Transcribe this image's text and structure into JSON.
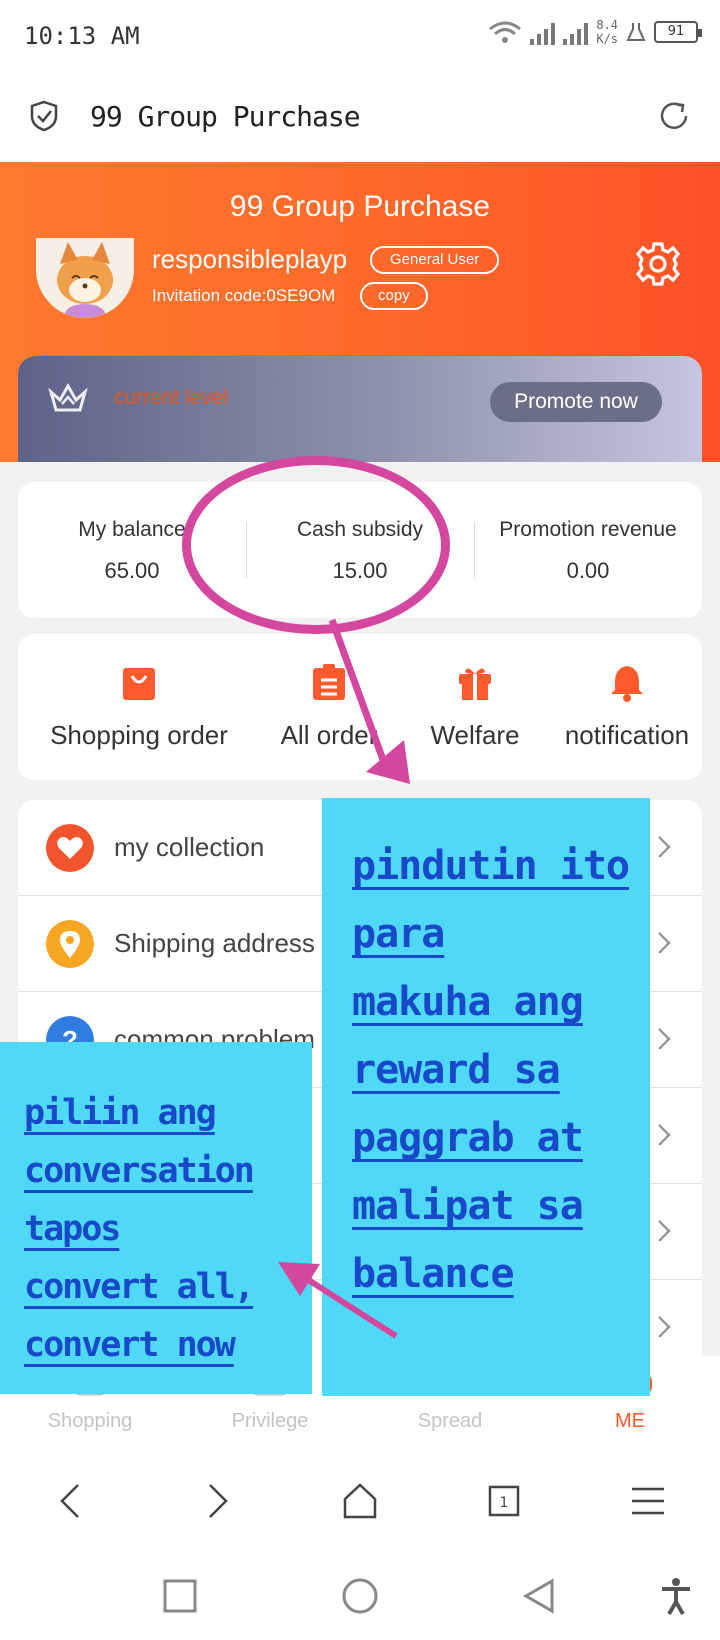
{
  "status_bar": {
    "time": "10:13 AM",
    "net_speed_value": "8.4",
    "net_speed_unit": "K/s",
    "battery": "91"
  },
  "browser": {
    "title": "99 Group Purchase"
  },
  "header": {
    "title": "99 Group Purchase",
    "username": "responsibleplayp",
    "role": "General User",
    "invitation": "Invitation code:0SE9OM",
    "copy_label": "copy"
  },
  "level": {
    "label": "current level",
    "promote_label": "Promote now"
  },
  "balances": [
    {
      "label": "My balance",
      "value": "65.00"
    },
    {
      "label": "Cash subsidy",
      "value": "15.00"
    },
    {
      "label": "Promotion revenue",
      "value": "0.00"
    }
  ],
  "orders": [
    {
      "label": "Shopping order",
      "icon": "shopping-bag-icon"
    },
    {
      "label": "All order",
      "icon": "clipboard-icon"
    },
    {
      "label": "Welfare",
      "icon": "gift-icon"
    },
    {
      "label": "notification",
      "icon": "bell-icon"
    }
  ],
  "menu": [
    {
      "label": "my collection",
      "icon": "heart-icon",
      "color": "#f2542d"
    },
    {
      "label": "Shipping address",
      "icon": "location-pin-icon",
      "color": "#f6a623"
    },
    {
      "label": "common problem",
      "icon": "question-icon",
      "color": "#2f7de1"
    }
  ],
  "tabs": [
    {
      "label": "Shopping",
      "active": false
    },
    {
      "label": "Privilege",
      "active": false
    },
    {
      "label": "Spread",
      "active": false
    },
    {
      "label": "ME",
      "active": true
    }
  ],
  "annotations": {
    "right_note": "pindutin ito\npara\nmakuha ang\nreward sa\npaggrab at\nmalipat sa\nbalance",
    "left_note": "piliin ang\nconversation\ntapos\nconvert all,\nconvert now"
  },
  "colors": {
    "accent": "#ff5a2c",
    "annotation_bg": "#4fd9f7",
    "annotation_text": "#1749c9",
    "annotation_mark": "#d4479e"
  }
}
